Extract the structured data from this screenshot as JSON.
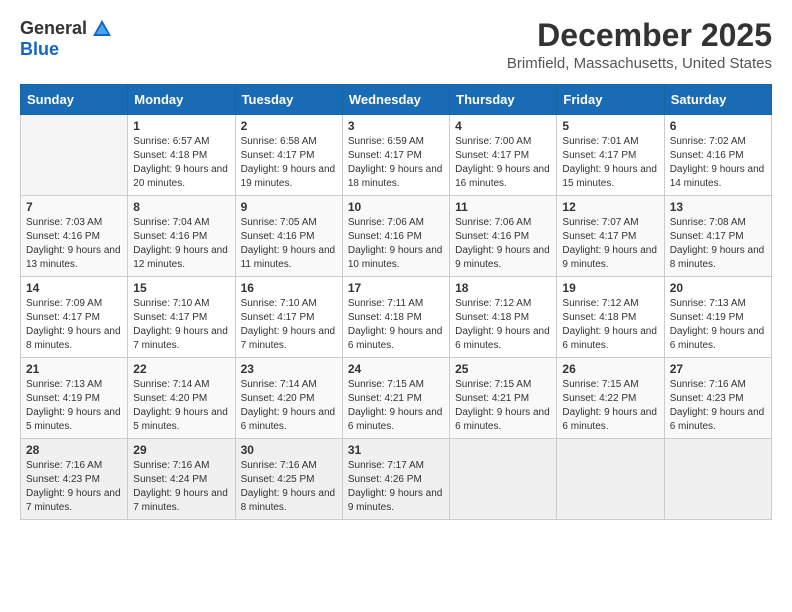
{
  "logo": {
    "general": "General",
    "blue": "Blue"
  },
  "title": "December 2025",
  "subtitle": "Brimfield, Massachusetts, United States",
  "days_header": [
    "Sunday",
    "Monday",
    "Tuesday",
    "Wednesday",
    "Thursday",
    "Friday",
    "Saturday"
  ],
  "weeks": [
    [
      {
        "day": "",
        "sunrise": "",
        "sunset": "",
        "daylight": ""
      },
      {
        "day": "1",
        "sunrise": "Sunrise: 6:57 AM",
        "sunset": "Sunset: 4:18 PM",
        "daylight": "Daylight: 9 hours and 20 minutes."
      },
      {
        "day": "2",
        "sunrise": "Sunrise: 6:58 AM",
        "sunset": "Sunset: 4:17 PM",
        "daylight": "Daylight: 9 hours and 19 minutes."
      },
      {
        "day": "3",
        "sunrise": "Sunrise: 6:59 AM",
        "sunset": "Sunset: 4:17 PM",
        "daylight": "Daylight: 9 hours and 18 minutes."
      },
      {
        "day": "4",
        "sunrise": "Sunrise: 7:00 AM",
        "sunset": "Sunset: 4:17 PM",
        "daylight": "Daylight: 9 hours and 16 minutes."
      },
      {
        "day": "5",
        "sunrise": "Sunrise: 7:01 AM",
        "sunset": "Sunset: 4:17 PM",
        "daylight": "Daylight: 9 hours and 15 minutes."
      },
      {
        "day": "6",
        "sunrise": "Sunrise: 7:02 AM",
        "sunset": "Sunset: 4:16 PM",
        "daylight": "Daylight: 9 hours and 14 minutes."
      }
    ],
    [
      {
        "day": "7",
        "sunrise": "Sunrise: 7:03 AM",
        "sunset": "Sunset: 4:16 PM",
        "daylight": "Daylight: 9 hours and 13 minutes."
      },
      {
        "day": "8",
        "sunrise": "Sunrise: 7:04 AM",
        "sunset": "Sunset: 4:16 PM",
        "daylight": "Daylight: 9 hours and 12 minutes."
      },
      {
        "day": "9",
        "sunrise": "Sunrise: 7:05 AM",
        "sunset": "Sunset: 4:16 PM",
        "daylight": "Daylight: 9 hours and 11 minutes."
      },
      {
        "day": "10",
        "sunrise": "Sunrise: 7:06 AM",
        "sunset": "Sunset: 4:16 PM",
        "daylight": "Daylight: 9 hours and 10 minutes."
      },
      {
        "day": "11",
        "sunrise": "Sunrise: 7:06 AM",
        "sunset": "Sunset: 4:16 PM",
        "daylight": "Daylight: 9 hours and 9 minutes."
      },
      {
        "day": "12",
        "sunrise": "Sunrise: 7:07 AM",
        "sunset": "Sunset: 4:17 PM",
        "daylight": "Daylight: 9 hours and 9 minutes."
      },
      {
        "day": "13",
        "sunrise": "Sunrise: 7:08 AM",
        "sunset": "Sunset: 4:17 PM",
        "daylight": "Daylight: 9 hours and 8 minutes."
      }
    ],
    [
      {
        "day": "14",
        "sunrise": "Sunrise: 7:09 AM",
        "sunset": "Sunset: 4:17 PM",
        "daylight": "Daylight: 9 hours and 8 minutes."
      },
      {
        "day": "15",
        "sunrise": "Sunrise: 7:10 AM",
        "sunset": "Sunset: 4:17 PM",
        "daylight": "Daylight: 9 hours and 7 minutes."
      },
      {
        "day": "16",
        "sunrise": "Sunrise: 7:10 AM",
        "sunset": "Sunset: 4:17 PM",
        "daylight": "Daylight: 9 hours and 7 minutes."
      },
      {
        "day": "17",
        "sunrise": "Sunrise: 7:11 AM",
        "sunset": "Sunset: 4:18 PM",
        "daylight": "Daylight: 9 hours and 6 minutes."
      },
      {
        "day": "18",
        "sunrise": "Sunrise: 7:12 AM",
        "sunset": "Sunset: 4:18 PM",
        "daylight": "Daylight: 9 hours and 6 minutes."
      },
      {
        "day": "19",
        "sunrise": "Sunrise: 7:12 AM",
        "sunset": "Sunset: 4:18 PM",
        "daylight": "Daylight: 9 hours and 6 minutes."
      },
      {
        "day": "20",
        "sunrise": "Sunrise: 7:13 AM",
        "sunset": "Sunset: 4:19 PM",
        "daylight": "Daylight: 9 hours and 6 minutes."
      }
    ],
    [
      {
        "day": "21",
        "sunrise": "Sunrise: 7:13 AM",
        "sunset": "Sunset: 4:19 PM",
        "daylight": "Daylight: 9 hours and 5 minutes."
      },
      {
        "day": "22",
        "sunrise": "Sunrise: 7:14 AM",
        "sunset": "Sunset: 4:20 PM",
        "daylight": "Daylight: 9 hours and 5 minutes."
      },
      {
        "day": "23",
        "sunrise": "Sunrise: 7:14 AM",
        "sunset": "Sunset: 4:20 PM",
        "daylight": "Daylight: 9 hours and 6 minutes."
      },
      {
        "day": "24",
        "sunrise": "Sunrise: 7:15 AM",
        "sunset": "Sunset: 4:21 PM",
        "daylight": "Daylight: 9 hours and 6 minutes."
      },
      {
        "day": "25",
        "sunrise": "Sunrise: 7:15 AM",
        "sunset": "Sunset: 4:21 PM",
        "daylight": "Daylight: 9 hours and 6 minutes."
      },
      {
        "day": "26",
        "sunrise": "Sunrise: 7:15 AM",
        "sunset": "Sunset: 4:22 PM",
        "daylight": "Daylight: 9 hours and 6 minutes."
      },
      {
        "day": "27",
        "sunrise": "Sunrise: 7:16 AM",
        "sunset": "Sunset: 4:23 PM",
        "daylight": "Daylight: 9 hours and 6 minutes."
      }
    ],
    [
      {
        "day": "28",
        "sunrise": "Sunrise: 7:16 AM",
        "sunset": "Sunset: 4:23 PM",
        "daylight": "Daylight: 9 hours and 7 minutes."
      },
      {
        "day": "29",
        "sunrise": "Sunrise: 7:16 AM",
        "sunset": "Sunset: 4:24 PM",
        "daylight": "Daylight: 9 hours and 7 minutes."
      },
      {
        "day": "30",
        "sunrise": "Sunrise: 7:16 AM",
        "sunset": "Sunset: 4:25 PM",
        "daylight": "Daylight: 9 hours and 8 minutes."
      },
      {
        "day": "31",
        "sunrise": "Sunrise: 7:17 AM",
        "sunset": "Sunset: 4:26 PM",
        "daylight": "Daylight: 9 hours and 9 minutes."
      },
      {
        "day": "",
        "sunrise": "",
        "sunset": "",
        "daylight": ""
      },
      {
        "day": "",
        "sunrise": "",
        "sunset": "",
        "daylight": ""
      },
      {
        "day": "",
        "sunrise": "",
        "sunset": "",
        "daylight": ""
      }
    ]
  ],
  "colors": {
    "header_bg": "#1a6bb5",
    "header_text": "#ffffff"
  }
}
